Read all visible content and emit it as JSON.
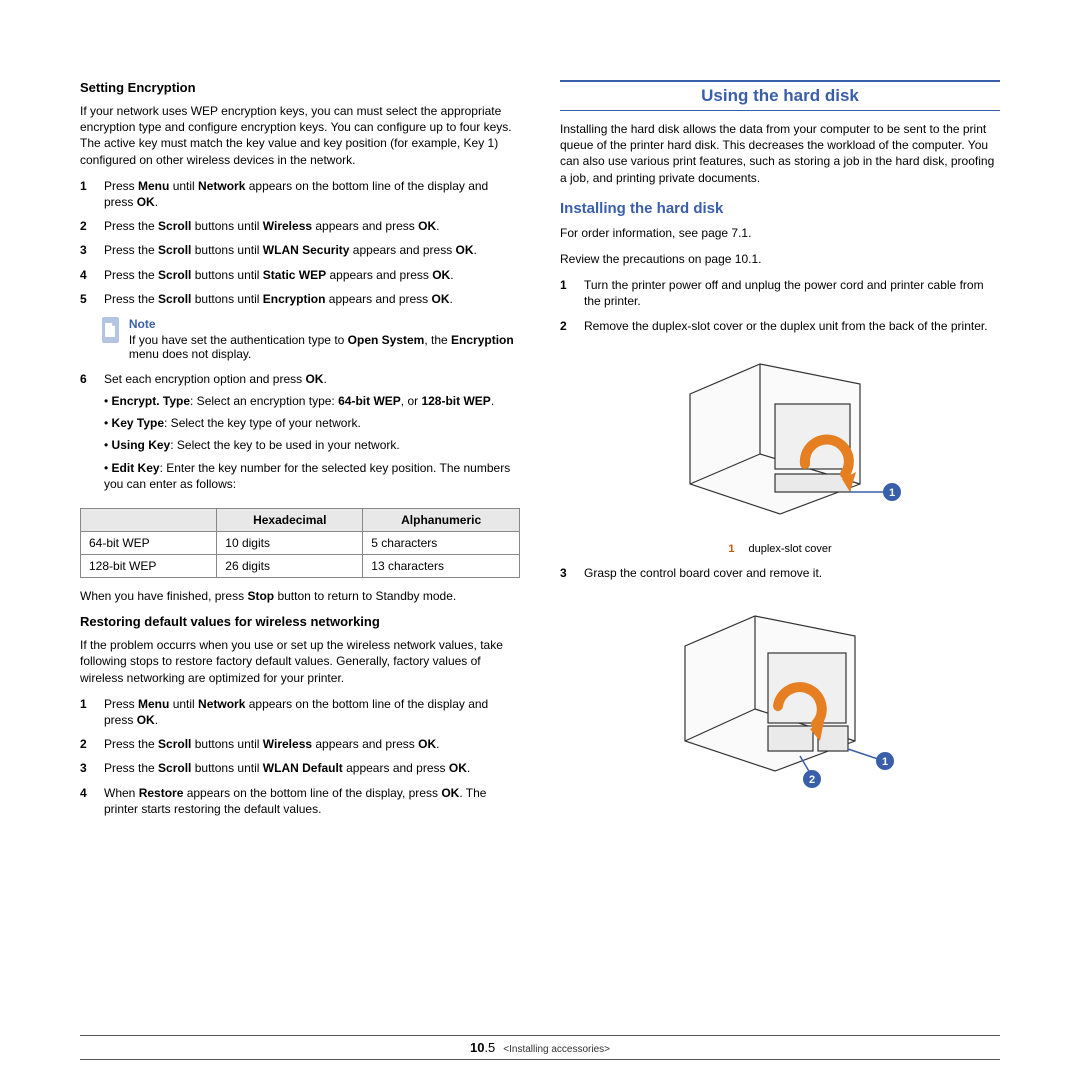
{
  "left": {
    "h_setting_encryption": "Setting Encryption",
    "p_intro": "If your network uses WEP encryption keys, you can must select the appropriate encryption type and configure encryption keys. You can configure up to four keys. The active key must match the key value and key position (for example, Key 1) configured on other wireless devices in the network.",
    "s1": "Press <b>Menu</b> until <b>Network</b> appears on the bottom line of the display and press <b>OK</b>.",
    "s2": "Press the <b>Scroll</b> buttons until <b>Wireless</b> appears and press <b>OK</b>.",
    "s3": "Press the <b>Scroll</b> buttons until <b>WLAN Security</b> appears and press <b>OK</b>.",
    "s4": "Press the <b>Scroll</b> buttons until <b>Static WEP</b> appears and press <b>OK</b>.",
    "s5": "Press the <b>Scroll</b> buttons until <b>Encryption</b> appears and press <b>OK</b>.",
    "note_title": "Note",
    "note_body": "If you have set the authentication type to <b>Open System</b>, the <b>Encryption</b> menu does not display.",
    "s6": "Set each encryption option and press <b>OK</b>.",
    "opt1": "• <b>Encrypt. Type</b>: Select an encryption type: <b>64-bit WEP</b>, or <b>128-bit WEP</b>.",
    "opt2": "• <b>Key Type</b>: Select the key type of your network.",
    "opt3": "• <b>Using Key</b>: Select the key to be used in your network.",
    "opt4": "• <b>Edit Key</b>: Enter the key number for the selected key position. The numbers you can enter as follows:",
    "tbl": {
      "h0": "",
      "h1": "Hexadecimal",
      "h2": "Alphanumeric",
      "r1c0": "64-bit WEP",
      "r1c1": "10 digits",
      "r1c2": "5 characters",
      "r2c0": "128-bit WEP",
      "r2c1": "26 digits",
      "r2c2": "13 characters"
    },
    "p_stop": "When you have finished, press <b>Stop</b> button to return to Standby mode.",
    "h_restore": "Restoring default values for wireless networking",
    "p_restore": "If the problem occurrs when you use or set up the wireless network values, take following stops to restore factory default values. Generally, factory values of wireless networking are optimized for your printer.",
    "r1": "Press <b>Menu</b> until <b>Network</b> appears on the bottom line of the display and press <b>OK</b>.",
    "r2": "Press the <b>Scroll</b> buttons until <b>Wireless</b> appears and press <b>OK</b>.",
    "r3": "Press the <b>Scroll</b> buttons until <b>WLAN Default</b> appears and press <b>OK</b>.",
    "r4": "When  <b>Restore</b> appears on the bottom line of the display, press <b>OK</b>. The printer starts restoring the default values."
  },
  "right": {
    "section_title": "Using the hard disk",
    "p_intro": "Installing the hard disk allows the data from your computer to be sent to the print queue of the printer hard disk. This decreases the workload of the computer. You can also use various print features, such as storing a job in the hard disk, proofing a job, and printing private documents.",
    "sub_install": "Installing the hard disk",
    "p_order": "For order information, see page 7.1.",
    "p_review": "Review the precautions on page 10.1.",
    "i1": "Turn the printer power off and unplug the power cord and printer cable from the printer.",
    "i2": "Remove the duplex-slot cover or the duplex unit from the back of the printer.",
    "fig1_num": "1",
    "fig1_cap": "duplex-slot cover",
    "i3": "Grasp the control board cover and remove it."
  },
  "footer": {
    "page_num": "10",
    "page_sub": ".5",
    "chapter": "<Installing accessories>"
  }
}
